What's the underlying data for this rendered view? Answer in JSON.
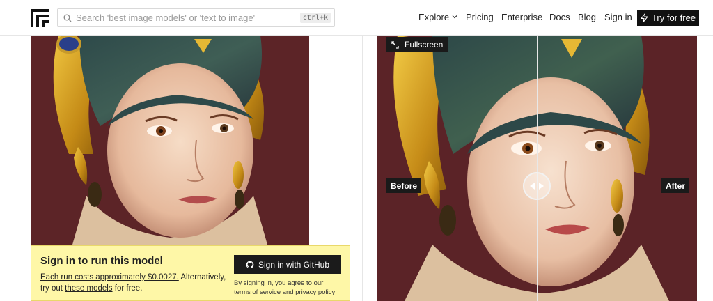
{
  "header": {
    "search": {
      "placeholder": "Search 'best image models' or 'text to image'",
      "shortcut": "ctrl+k"
    },
    "nav": [
      {
        "label": "Explore",
        "has_dropdown": true
      },
      {
        "label": "Pricing"
      },
      {
        "label": "Enterprise"
      },
      {
        "label": "Docs"
      },
      {
        "label": "Blog"
      },
      {
        "label": "Sign in"
      }
    ],
    "cta": {
      "label": "Try for free",
      "icon": "lightning-icon"
    }
  },
  "signin": {
    "title": "Sign in to run this model",
    "cost_link": "Each run costs approximately $0.0027.",
    "text_mid": " Alternatively, try out ",
    "models_link": "these models",
    "text_end": " for free.",
    "github_button": "Sign in with GitHub",
    "terms_prefix": "By signing in, you agree to our",
    "terms_link": "terms of service",
    "terms_and": " and ",
    "privacy_link": "privacy policy"
  },
  "compare": {
    "fullscreen_label": "Fullscreen",
    "before_label": "Before",
    "after_label": "After",
    "slider_position": 0.5
  },
  "colors": {
    "accent_dark": "#111111",
    "signin_bg": "#fef7a7",
    "portrait_bg": "#5a2226"
  }
}
